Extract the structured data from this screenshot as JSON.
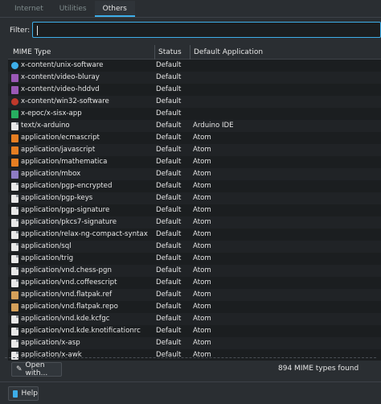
{
  "tabs": [
    {
      "label": "Internet",
      "active": false
    },
    {
      "label": "Utilities",
      "active": false
    },
    {
      "label": "Others",
      "active": true
    }
  ],
  "filter": {
    "label": "Filter:",
    "value": ""
  },
  "table": {
    "columns": [
      "MIME Type",
      "Status",
      "Default Application"
    ],
    "rows": [
      {
        "mime": "x-content/unix-software",
        "status": "Default",
        "app": "",
        "icon": "cyan-disc-icon",
        "color": "#3daee9"
      },
      {
        "mime": "x-content/video-bluray",
        "status": "Default",
        "app": "",
        "icon": "video-icon",
        "color": "#9b59b6"
      },
      {
        "mime": "x-content/video-hddvd",
        "status": "Default",
        "app": "",
        "icon": "video-icon",
        "color": "#9b59b6"
      },
      {
        "mime": "x-content/win32-software",
        "status": "Default",
        "app": "",
        "icon": "wine-icon",
        "color": "#c0392b"
      },
      {
        "mime": "x-epoc/x-sisx-app",
        "status": "Default",
        "app": "",
        "icon": "app-icon",
        "color": "#27ae60"
      },
      {
        "mime": "text/x-arduino",
        "status": "Default",
        "app": "Arduino IDE",
        "icon": "text-file-icon",
        "color": "#e8e8e8"
      },
      {
        "mime": "application/ecmascript",
        "status": "Default",
        "app": "Atom",
        "icon": "script-icon",
        "color": "#e67e22"
      },
      {
        "mime": "application/javascript",
        "status": "Default",
        "app": "Atom",
        "icon": "script-icon",
        "color": "#e67e22"
      },
      {
        "mime": "application/mathematica",
        "status": "Default",
        "app": "Atom",
        "icon": "script-icon",
        "color": "#e67e22"
      },
      {
        "mime": "application/mbox",
        "status": "Default",
        "app": "Atom",
        "icon": "mail-icon",
        "color": "#8e7cc3"
      },
      {
        "mime": "application/pgp-encrypted",
        "status": "Default",
        "app": "Atom",
        "icon": "encrypted-file-icon",
        "color": "#e8e8e8"
      },
      {
        "mime": "application/pgp-keys",
        "status": "Default",
        "app": "Atom",
        "icon": "key-file-icon",
        "color": "#e8e8e8"
      },
      {
        "mime": "application/pgp-signature",
        "status": "Default",
        "app": "Atom",
        "icon": "signature-file-icon",
        "color": "#e8e8e8"
      },
      {
        "mime": "application/pkcs7-signature",
        "status": "Default",
        "app": "Atom",
        "icon": "signature-file-icon",
        "color": "#e8e8e8"
      },
      {
        "mime": "application/relax-ng-compact-syntax",
        "status": "Default",
        "app": "Atom",
        "icon": "text-file-icon",
        "color": "#e8e8e8"
      },
      {
        "mime": "application/sql",
        "status": "Default",
        "app": "Atom",
        "icon": "text-file-icon",
        "color": "#e8e8e8"
      },
      {
        "mime": "application/trig",
        "status": "Default",
        "app": "Atom",
        "icon": "text-file-icon",
        "color": "#e8e8e8"
      },
      {
        "mime": "application/vnd.chess-pgn",
        "status": "Default",
        "app": "Atom",
        "icon": "text-file-icon",
        "color": "#e8e8e8"
      },
      {
        "mime": "application/vnd.coffeescript",
        "status": "Default",
        "app": "Atom",
        "icon": "text-file-icon",
        "color": "#e8e8e8"
      },
      {
        "mime": "application/vnd.flatpak.ref",
        "status": "Default",
        "app": "Atom",
        "icon": "package-icon",
        "color": "#d4a05a"
      },
      {
        "mime": "application/vnd.flatpak.repo",
        "status": "Default",
        "app": "Atom",
        "icon": "package-icon",
        "color": "#d4a05a"
      },
      {
        "mime": "application/vnd.kde.kcfgc",
        "status": "Default",
        "app": "Atom",
        "icon": "text-file-icon",
        "color": "#e8e8e8"
      },
      {
        "mime": "application/vnd.kde.knotificationrc",
        "status": "Default",
        "app": "Atom",
        "icon": "text-file-icon",
        "color": "#e8e8e8"
      },
      {
        "mime": "application/x-asp",
        "status": "Default",
        "app": "Atom",
        "icon": "text-file-icon",
        "color": "#e8e8e8"
      },
      {
        "mime": "application/x-awk",
        "status": "Default",
        "app": "Atom",
        "icon": "text-file-icon",
        "color": "#e8e8e8"
      }
    ]
  },
  "bottom": {
    "open_with_label": "Open with...",
    "found_label": "894 MIME types found"
  },
  "help_label": "Help",
  "colors": {
    "accent": "#3daee9",
    "background": "#2a2e32",
    "list_background": "#1b1e20"
  }
}
